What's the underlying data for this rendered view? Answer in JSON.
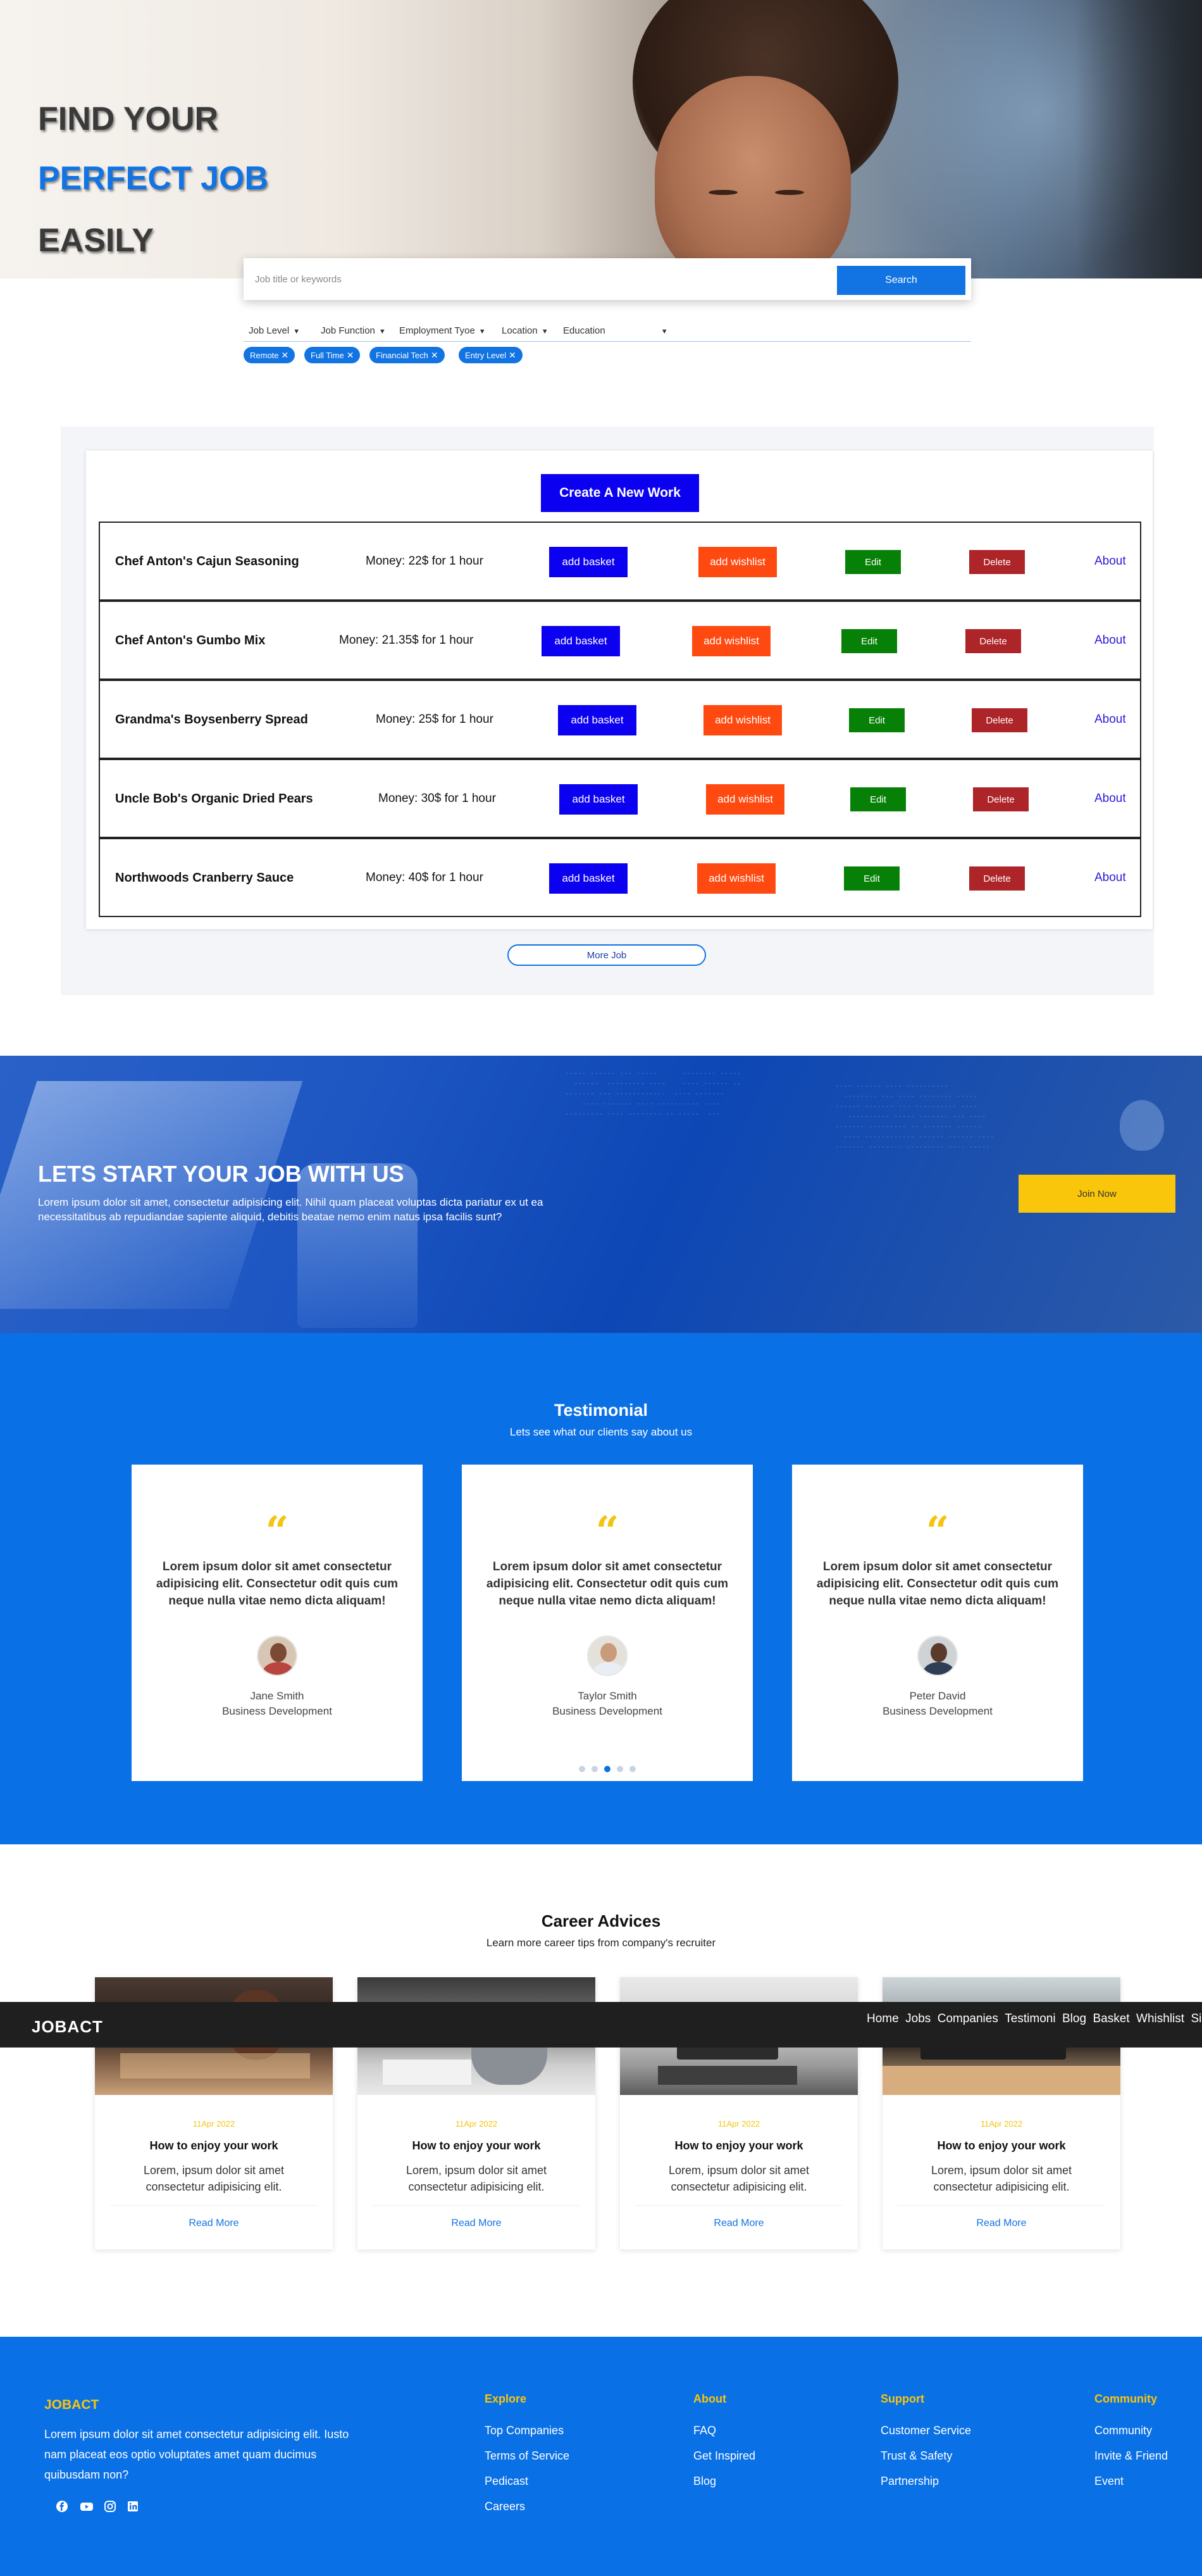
{
  "hero": {
    "line1": "FIND YOUR",
    "line2": "PERFECT JOB",
    "line3": "EASILY"
  },
  "search": {
    "placeholder": "Job title or keywords",
    "button": "Search"
  },
  "filters": [
    "Job Level",
    "Job Function",
    "Employment Tyoe",
    "Location",
    "Education"
  ],
  "tags": [
    "Remote",
    "Full Time",
    "Financial Tech",
    "Entry Level"
  ],
  "jobs": {
    "create_label": "Create A New Work",
    "basket_label": "add basket",
    "wishlist_label": "add wishlist",
    "edit_label": "Edit",
    "delete_label": "Delete",
    "about_label": "About",
    "items": [
      {
        "name": "Chef Anton's Cajun Seasoning",
        "money": "Money: 22$ for 1 hour"
      },
      {
        "name": "Chef Anton's Gumbo Mix",
        "money": "Money: 21.35$ for 1 hour"
      },
      {
        "name": "Grandma's Boysenberry Spread",
        "money": "Money: 25$ for 1 hour"
      },
      {
        "name": "Uncle Bob's Organic Dried Pears",
        "money": "Money: 30$ for 1 hour"
      },
      {
        "name": "Northwoods Cranberry Sauce",
        "money": "Money: 40$ for 1 hour"
      }
    ],
    "more_label": "More Job"
  },
  "banner": {
    "title": "LETS START YOUR JOB WITH US",
    "text": "Lorem ipsum dolor sit amet, consectetur adipisicing elit. Nihil quam placeat voluptas dicta pariatur ex ut ea necessitatibus ab repudiandae sapiente aliquid, debitis beatae nemo enim natus ipsa facilis sunt?",
    "button": "Join Now"
  },
  "testimonial": {
    "title": "Testimonial",
    "subtitle": "Lets see what our clients say about us",
    "quote_mark": "“",
    "cards": [
      {
        "text": "Lorem ipsum dolor sit amet consectetur adipisicing elit. Consectetur odit quis cum neque nulla vitae nemo dicta aliquam!",
        "name": "Jane Smith",
        "role": "Business Development"
      },
      {
        "text": "Lorem ipsum dolor sit amet consectetur adipisicing elit. Consectetur odit quis cum neque nulla vitae nemo dicta aliquam!",
        "name": "Taylor Smith",
        "role": "Business Development"
      },
      {
        "text": "Lorem ipsum dolor sit amet consectetur adipisicing elit. Consectetur odit quis cum neque nulla vitae nemo dicta aliquam!",
        "name": "Peter David",
        "role": "Business Development"
      }
    ],
    "active_dot": 3,
    "dot_count": 5
  },
  "career": {
    "title": "Career Advices",
    "subtitle": "Learn more career tips from company's recruiter",
    "cards": [
      {
        "date": "11Apr 2022",
        "title": "How to enjoy your work",
        "text": "Lorem, ipsum dolor sit amet consectetur adipisicing elit.",
        "read": "Read More"
      },
      {
        "date": "11Apr 2022",
        "title": "How to enjoy your work",
        "text": "Lorem, ipsum dolor sit amet consectetur adipisicing elit.",
        "read": "Read More"
      },
      {
        "date": "11Apr 2022",
        "title": "How to enjoy your work",
        "text": "Lorem, ipsum dolor sit amet consectetur adipisicing elit.",
        "read": "Read More"
      },
      {
        "date": "11Apr 2022",
        "title": "How to enjoy your work",
        "text": "Lorem, ipsum dolor sit amet consectetur adipisicing elit.",
        "read": "Read More"
      }
    ]
  },
  "navbar": {
    "logo": "JOBACT",
    "links": [
      "Home",
      "Jobs",
      "Companies",
      "Testimoni",
      "Blog",
      "Basket",
      "Whishlist",
      "Sign In"
    ]
  },
  "footer": {
    "logo": "JOBACT",
    "text": "Lorem ipsum dolor sit amet consectetur adipisicing elit. Iusto nam placeat eos optio voluptates amet quam ducimus quibusdam non?",
    "social_icons": [
      "facebook-icon",
      "youtube-icon",
      "instagram-icon",
      "linkedin-icon"
    ],
    "columns": [
      {
        "heading": "Explore",
        "links": [
          "Top Companies",
          "Terms of Service",
          "Pedicast",
          "Careers"
        ]
      },
      {
        "heading": "About",
        "links": [
          "FAQ",
          "Get Inspired",
          "Blog"
        ]
      },
      {
        "heading": "Support",
        "links": [
          "Customer Service",
          "Trust & Safety",
          "Partnership"
        ]
      },
      {
        "heading": "Community",
        "links": [
          "Community",
          "Invite & Friend",
          "Event"
        ]
      }
    ]
  },
  "colors": {
    "primary_blue": "#1273e2",
    "accent_yellow": "#f9c60b",
    "basket_blue": "#0c00f0",
    "wishlist_orange": "#fe4a11",
    "edit_green": "#068006",
    "delete_red": "#ad2429"
  }
}
